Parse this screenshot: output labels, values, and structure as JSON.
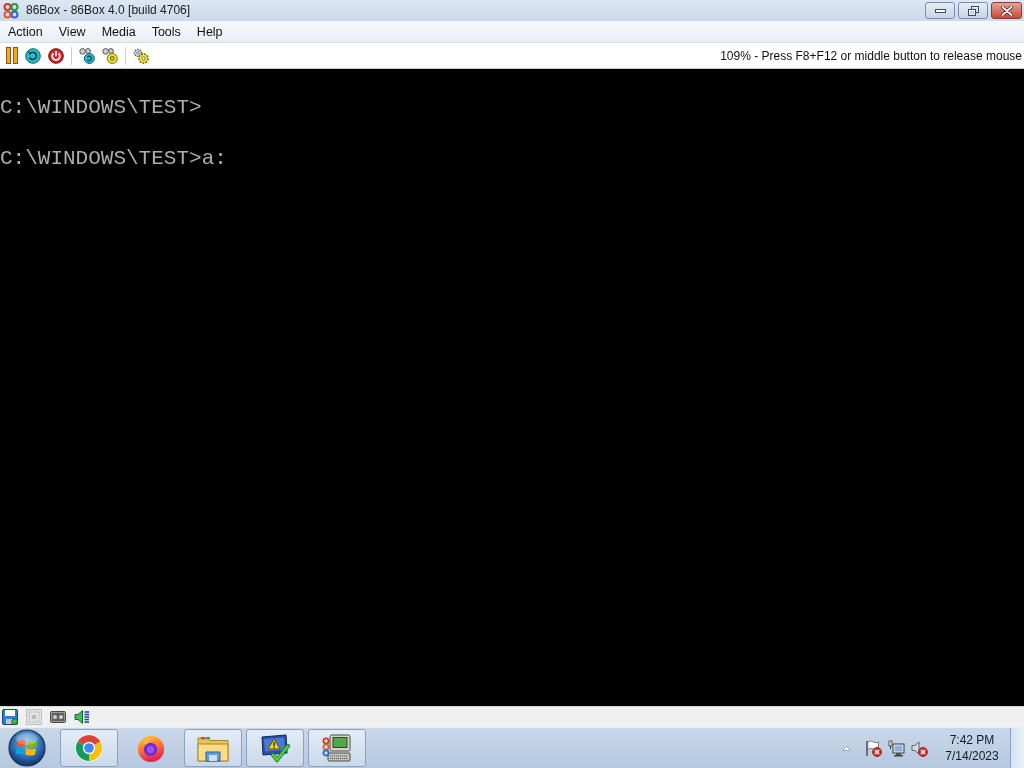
{
  "window": {
    "title": "86Box - 86Box 4.0 [build 4706]"
  },
  "menu": [
    "Action",
    "View",
    "Media",
    "Tools",
    "Help"
  ],
  "toolbar": {
    "status": "109% - Press F8+F12 or middle button to release mouse"
  },
  "screen": {
    "lines": [
      "C:\\WINDOWS\\TEST>",
      "C:\\WINDOWS\\TEST>a:"
    ]
  },
  "taskbar": {
    "apps": [
      {
        "running": true
      },
      {
        "running": false
      },
      {
        "running": true
      },
      {
        "running": true
      },
      {
        "running": true
      }
    ]
  },
  "tray": {
    "flag_alert": true,
    "volume_muted": true,
    "time": "7:42 PM",
    "date": "7/14/2023"
  }
}
